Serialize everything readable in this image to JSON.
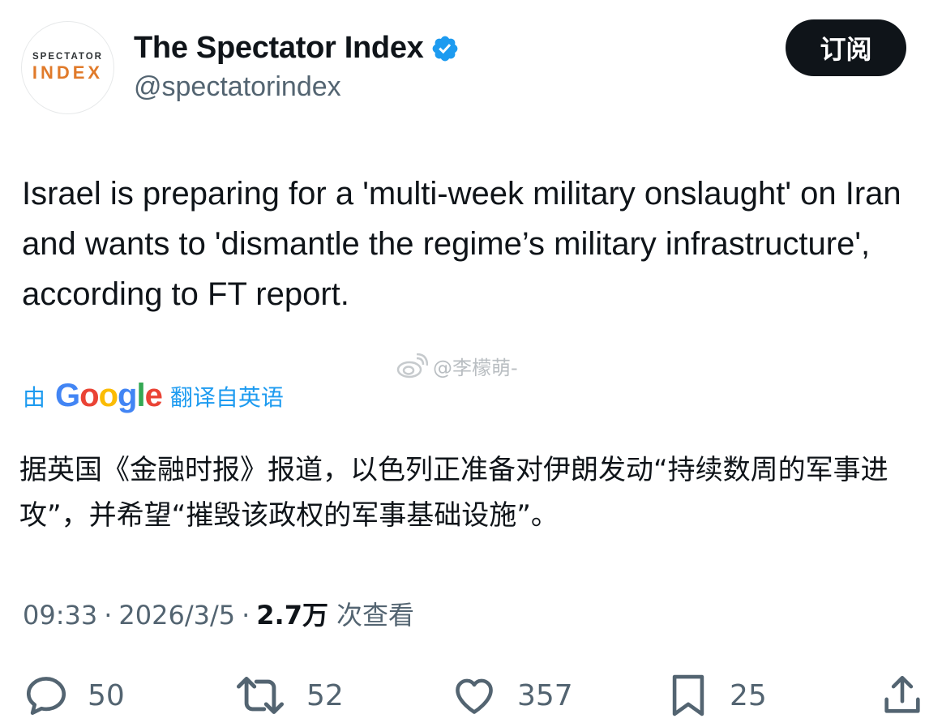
{
  "profile": {
    "avatar_top": "SPECTATOR",
    "avatar_bottom": "INDEX",
    "display_name": "The Spectator Index",
    "handle": "@spectatorindex",
    "subscribe_label": "订阅"
  },
  "tweet": {
    "text": "Israel is preparing for a 'multi-week military onslaught' on Iran and wants to 'dismantle the regime’s military infrastructure', according to FT report.",
    "watermark": "@李檬萌-"
  },
  "translation": {
    "by_label": "由",
    "provider": "Google",
    "from_label": "翻译自英语",
    "text": "据英国《金融时报》报道，以色列正准备对伊朗发动“持续数周的军事进攻”，并希望“摧毁该政权的军事基础设施”。"
  },
  "meta": {
    "time": "09:33",
    "date": "2026/3/5",
    "separator": "·",
    "views": "2.7万",
    "views_label": "次查看"
  },
  "actions": {
    "replies": "50",
    "retweets": "52",
    "likes": "357",
    "bookmarks": "25"
  },
  "colors": {
    "accent": "#1d9bf0",
    "text": "#0f1419",
    "secondary": "#536471",
    "avatar_orange": "#e07a2a"
  },
  "icons": [
    "verified-badge-icon",
    "weibo-icon",
    "reply-icon",
    "retweet-icon",
    "like-icon",
    "bookmark-icon",
    "share-icon"
  ]
}
